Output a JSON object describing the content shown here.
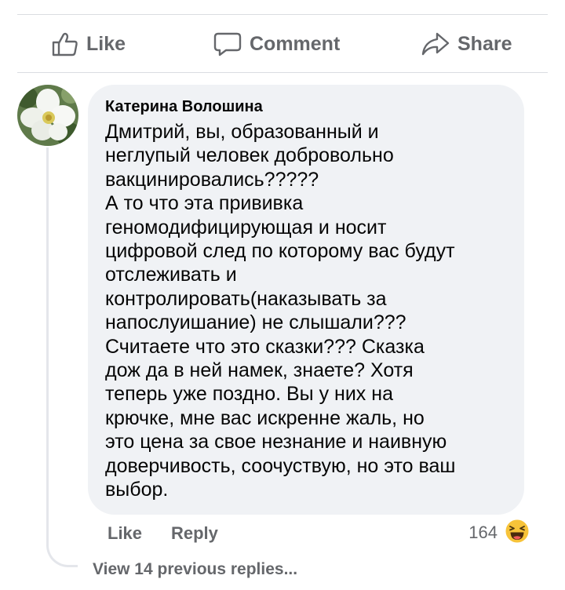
{
  "actions": {
    "like_label": "Like",
    "comment_label": "Comment",
    "share_label": "Share"
  },
  "comment": {
    "author": "Катерина Волошина",
    "text": "Дмитрий,  вы, образованный и\nнеглупый человек добровольно\nвакцинировались?????\nА то что эта прививка\nгеномодифицирующая и носит\nцифровой след по которому вас будут\nотслеживать и\nконтролировать(наказывать за\nнапослуишание) не слышали???\nСчитаете что это сказки???  Сказка\nдож да в ней намек,  знаете?  Хотя\nтеперь уже поздно. Вы у них на\nкрючке,  мне вас искренне жаль,  но\nэто цена за свое незнание и наивную\nдоверчивость, соочуствую,  но это ваш\nвыбор.",
    "like_label": "Like",
    "reply_label": "Reply",
    "reaction_count": "164",
    "reaction_icon": "laughing-emoji-icon"
  },
  "view_replies_label": "View 14 previous replies..."
}
